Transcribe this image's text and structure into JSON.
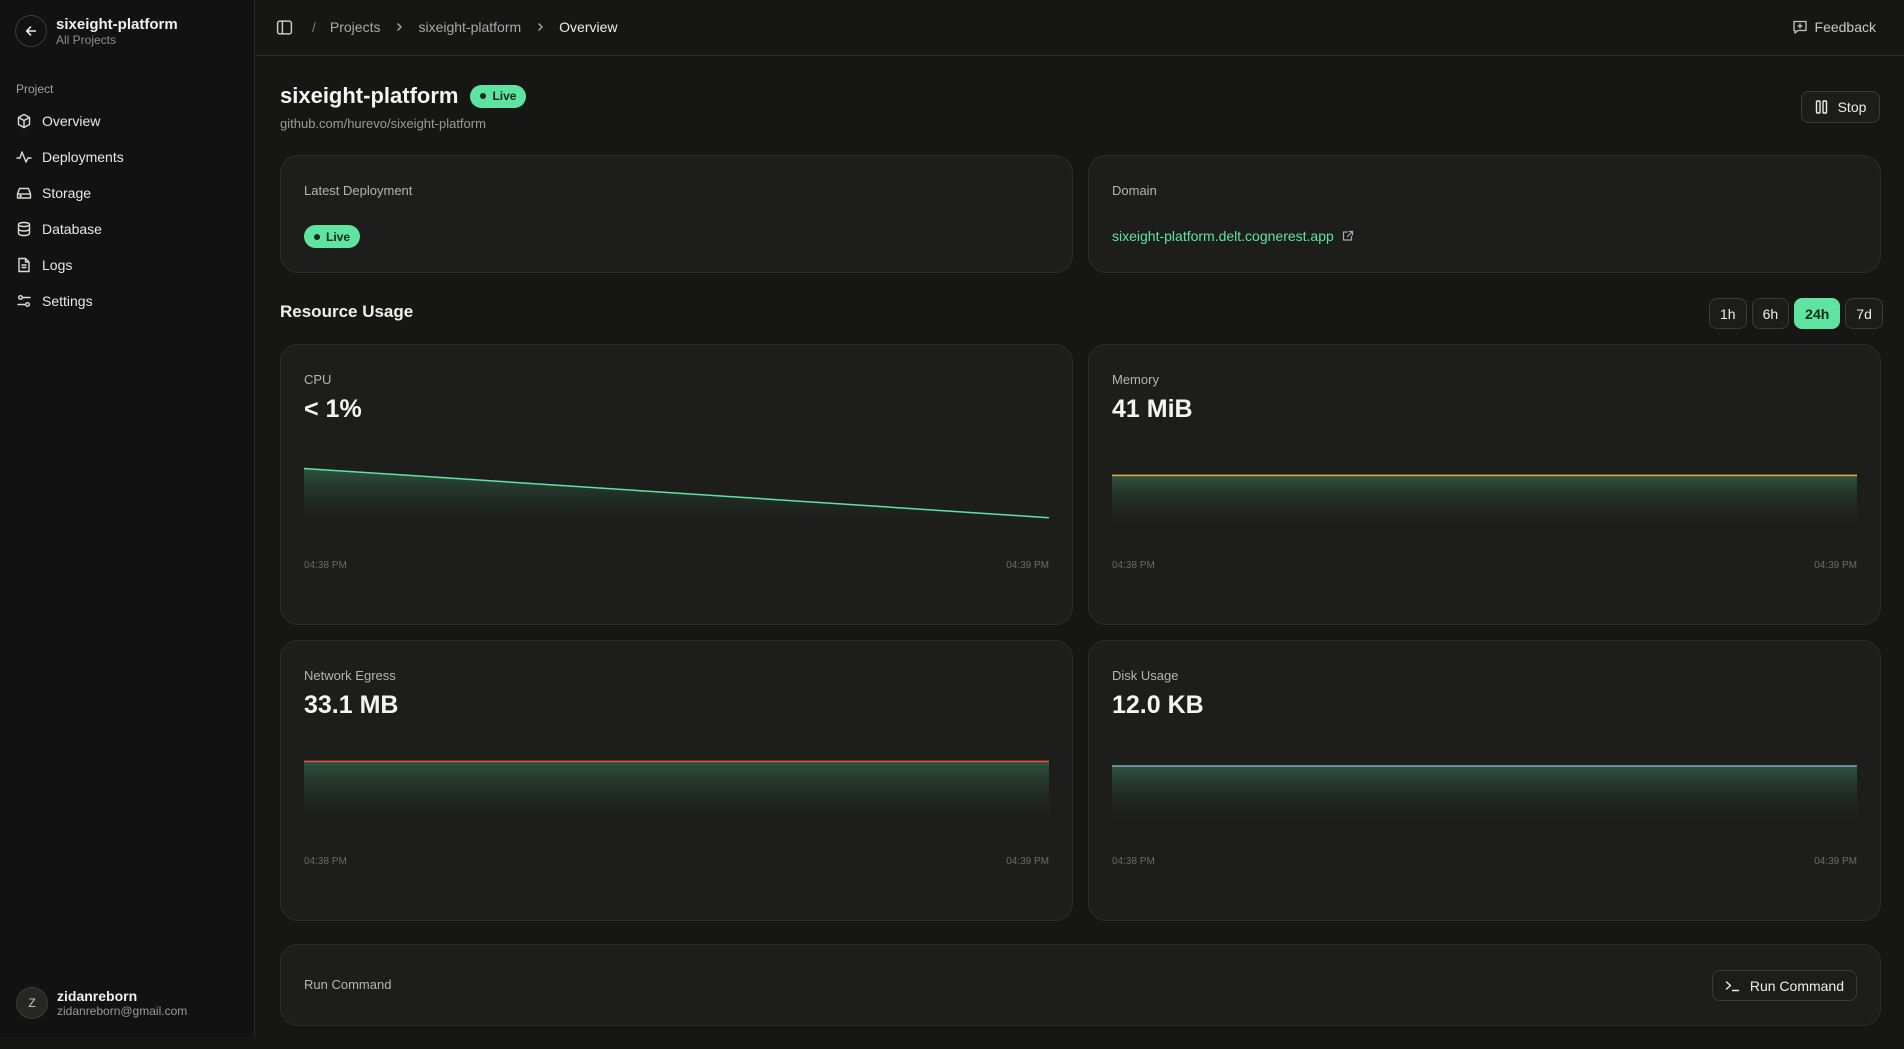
{
  "sidebar": {
    "project_name": "sixeight-platform",
    "project_sub": "All Projects",
    "section_label": "Project",
    "items": [
      {
        "label": "Overview",
        "icon": "cube-icon"
      },
      {
        "label": "Deployments",
        "icon": "activity-icon"
      },
      {
        "label": "Storage",
        "icon": "hard-drive-icon"
      },
      {
        "label": "Database",
        "icon": "database-icon"
      },
      {
        "label": "Logs",
        "icon": "file-text-icon"
      },
      {
        "label": "Settings",
        "icon": "sliders-icon"
      }
    ],
    "user": {
      "initial": "Z",
      "name": "zidanreborn",
      "email": "zidanreborn@gmail.com"
    }
  },
  "topbar": {
    "breadcrumb": [
      "Projects",
      "sixeight-platform",
      "Overview"
    ],
    "feedback_label": "Feedback"
  },
  "header": {
    "title": "sixeight-platform",
    "status": "Live",
    "repo": "github.com/hurevo/sixeight-platform",
    "stop_label": "Stop"
  },
  "deployment": {
    "label": "Latest Deployment",
    "status": "Live"
  },
  "domain": {
    "label": "Domain",
    "url": "sixeight-platform.delt.cognerest.app"
  },
  "resource": {
    "title": "Resource Usage",
    "ranges": [
      "1h",
      "6h",
      "24h",
      "7d"
    ],
    "active_range": "24h"
  },
  "metrics": {
    "cpu": {
      "label": "CPU",
      "value": "< 1%",
      "color": "#5ee4a0"
    },
    "memory": {
      "label": "Memory",
      "value": "41 MiB",
      "color": "#f0a83a"
    },
    "network": {
      "label": "Network Egress",
      "value": "33.1 MB",
      "color": "#e8553f"
    },
    "disk": {
      "label": "Disk Usage",
      "value": "12.0 KB",
      "color": "#7fa6c9"
    }
  },
  "chart_data": [
    {
      "type": "area",
      "title": "CPU",
      "x": [
        "04:38 PM",
        "04:39 PM"
      ],
      "series": [
        {
          "values": [
            0.5,
            0.1
          ]
        }
      ],
      "ylim": [
        0,
        0.65
      ]
    },
    {
      "type": "area",
      "title": "Memory",
      "x": [
        "04:38 PM",
        "04:39 PM"
      ],
      "series": [
        {
          "values": [
            41,
            41
          ]
        }
      ],
      "ylim": [
        0,
        60
      ]
    },
    {
      "type": "area",
      "title": "Network Egress",
      "x": [
        "04:38 PM",
        "04:39 PM"
      ],
      "series": [
        {
          "values": [
            33.1,
            33.1
          ]
        }
      ],
      "ylim": [
        0,
        41
      ]
    },
    {
      "type": "area",
      "title": "Disk Usage",
      "x": [
        "04:38 PM",
        "04:39 PM"
      ],
      "series": [
        {
          "values": [
            12.0,
            12.0
          ]
        }
      ],
      "ylim": [
        0,
        16
      ]
    }
  ],
  "run_command": {
    "label": "Run Command",
    "button_label": "Run Command"
  }
}
